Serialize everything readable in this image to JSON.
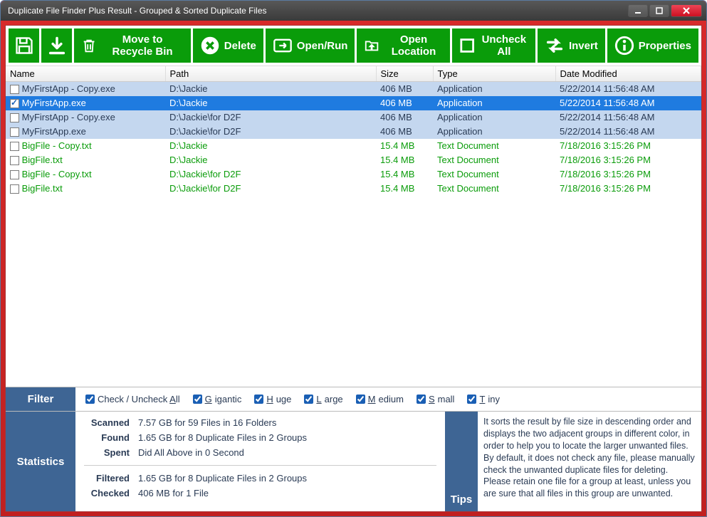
{
  "window": {
    "title": "Duplicate File Finder Plus Result - Grouped & Sorted Duplicate Files"
  },
  "toolbar": {
    "save": "",
    "load": "",
    "recycle": "Move to Recycle Bin",
    "delete": "Delete",
    "open": "Open/Run",
    "location": "Open Location",
    "uncheck": "Uncheck All",
    "invert": "Invert",
    "properties": "Properties"
  },
  "columns": {
    "name": "Name",
    "path": "Path",
    "size": "Size",
    "type": "Type",
    "date": "Date Modified"
  },
  "rows": [
    {
      "group": 0,
      "selected": false,
      "checked": false,
      "name": "MyFirstApp - Copy.exe",
      "path": "D:\\Jackie",
      "size": "406 MB",
      "type": "Application",
      "date": "5/22/2014 11:56:48 AM"
    },
    {
      "group": 0,
      "selected": true,
      "checked": true,
      "name": "MyFirstApp.exe",
      "path": "D:\\Jackie",
      "size": "406 MB",
      "type": "Application",
      "date": "5/22/2014 11:56:48 AM"
    },
    {
      "group": 0,
      "selected": false,
      "checked": false,
      "name": "MyFirstApp - Copy.exe",
      "path": "D:\\Jackie\\for D2F",
      "size": "406 MB",
      "type": "Application",
      "date": "5/22/2014 11:56:48 AM"
    },
    {
      "group": 0,
      "selected": false,
      "checked": false,
      "name": "MyFirstApp.exe",
      "path": "D:\\Jackie\\for D2F",
      "size": "406 MB",
      "type": "Application",
      "date": "5/22/2014 11:56:48 AM"
    },
    {
      "group": 1,
      "selected": false,
      "checked": false,
      "name": "BigFile - Copy.txt",
      "path": "D:\\Jackie",
      "size": "15.4 MB",
      "type": "Text Document",
      "date": "7/18/2016 3:15:26 PM"
    },
    {
      "group": 1,
      "selected": false,
      "checked": false,
      "name": "BigFile.txt",
      "path": "D:\\Jackie",
      "size": "15.4 MB",
      "type": "Text Document",
      "date": "7/18/2016 3:15:26 PM"
    },
    {
      "group": 1,
      "selected": false,
      "checked": false,
      "name": "BigFile - Copy.txt",
      "path": "D:\\Jackie\\for D2F",
      "size": "15.4 MB",
      "type": "Text Document",
      "date": "7/18/2016 3:15:26 PM"
    },
    {
      "group": 1,
      "selected": false,
      "checked": false,
      "name": "BigFile.txt",
      "path": "D:\\Jackie\\for D2F",
      "size": "15.4 MB",
      "type": "Text Document",
      "date": "7/18/2016 3:15:26 PM"
    }
  ],
  "filter": {
    "label": "Filter",
    "checkall": "Check / Uncheck All",
    "options": [
      "Gigantic",
      "Huge",
      "Large",
      "Medium",
      "Small",
      "Tiny"
    ]
  },
  "stats": {
    "label": "Statistics",
    "scanned_k": "Scanned",
    "scanned_v": "7.57 GB for 59 Files in 16 Folders",
    "found_k": "Found",
    "found_v": "1.65 GB for 8 Duplicate Files in 2 Groups",
    "spent_k": "Spent",
    "spent_v": "Did All Above in 0 Second",
    "filtered_k": "Filtered",
    "filtered_v": "1.65 GB for 8 Duplicate Files in 2 Groups",
    "checked_k": "Checked",
    "checked_v": "406 MB for 1 File"
  },
  "tips": {
    "label": "Tips",
    "text": "It sorts the result by file size in descending order and displays the two adjacent groups in different color, in order to help you to locate the larger unwanted files. By default, it does not check any file, please manually check the unwanted duplicate files for deleting. Please retain one file for a group at least, unless you are sure that all files in this group are unwanted."
  }
}
